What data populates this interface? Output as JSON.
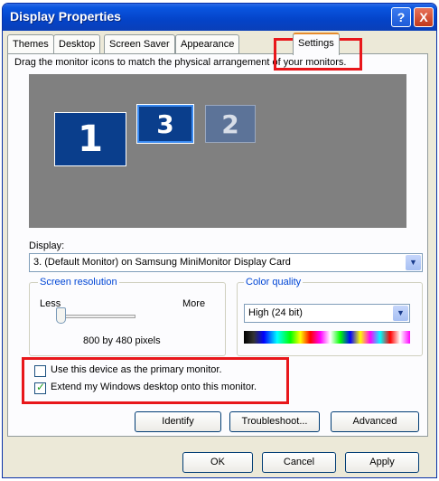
{
  "window": {
    "title": "Display Properties"
  },
  "title_buttons": {
    "help": "?",
    "close": "X"
  },
  "tabs": [
    {
      "label": "Themes"
    },
    {
      "label": "Desktop"
    },
    {
      "label": "Screen Saver"
    },
    {
      "label": "Appearance"
    },
    {
      "label": "Settings"
    }
  ],
  "instruction": "Drag the monitor icons to match the physical arrangement of your monitors.",
  "monitors": [
    {
      "label": "1"
    },
    {
      "label": "3"
    },
    {
      "label": "2"
    }
  ],
  "display": {
    "label": "Display:",
    "value": "3. (Default Monitor) on Samsung MiniMonitor Display Card"
  },
  "resolution": {
    "title": "Screen resolution",
    "less": "Less",
    "more": "More",
    "value": "800 by 480 pixels",
    "slider_level": 0
  },
  "color_quality": {
    "title": "Color quality",
    "value": "High (24 bit)"
  },
  "options": [
    {
      "label": "Use this device as the primary monitor.",
      "checked": false
    },
    {
      "label": "Extend my Windows desktop onto this monitor.",
      "checked": true
    }
  ],
  "actions": {
    "identify": "Identify",
    "troubleshoot": "Troubleshoot...",
    "advanced": "Advanced"
  },
  "dialog_buttons": {
    "ok": "OK",
    "cancel": "Cancel",
    "apply": "Apply"
  },
  "colors": {
    "title_bar": "#0A55E0",
    "highlight": "#E8171B",
    "monitor_area": "#808080"
  }
}
